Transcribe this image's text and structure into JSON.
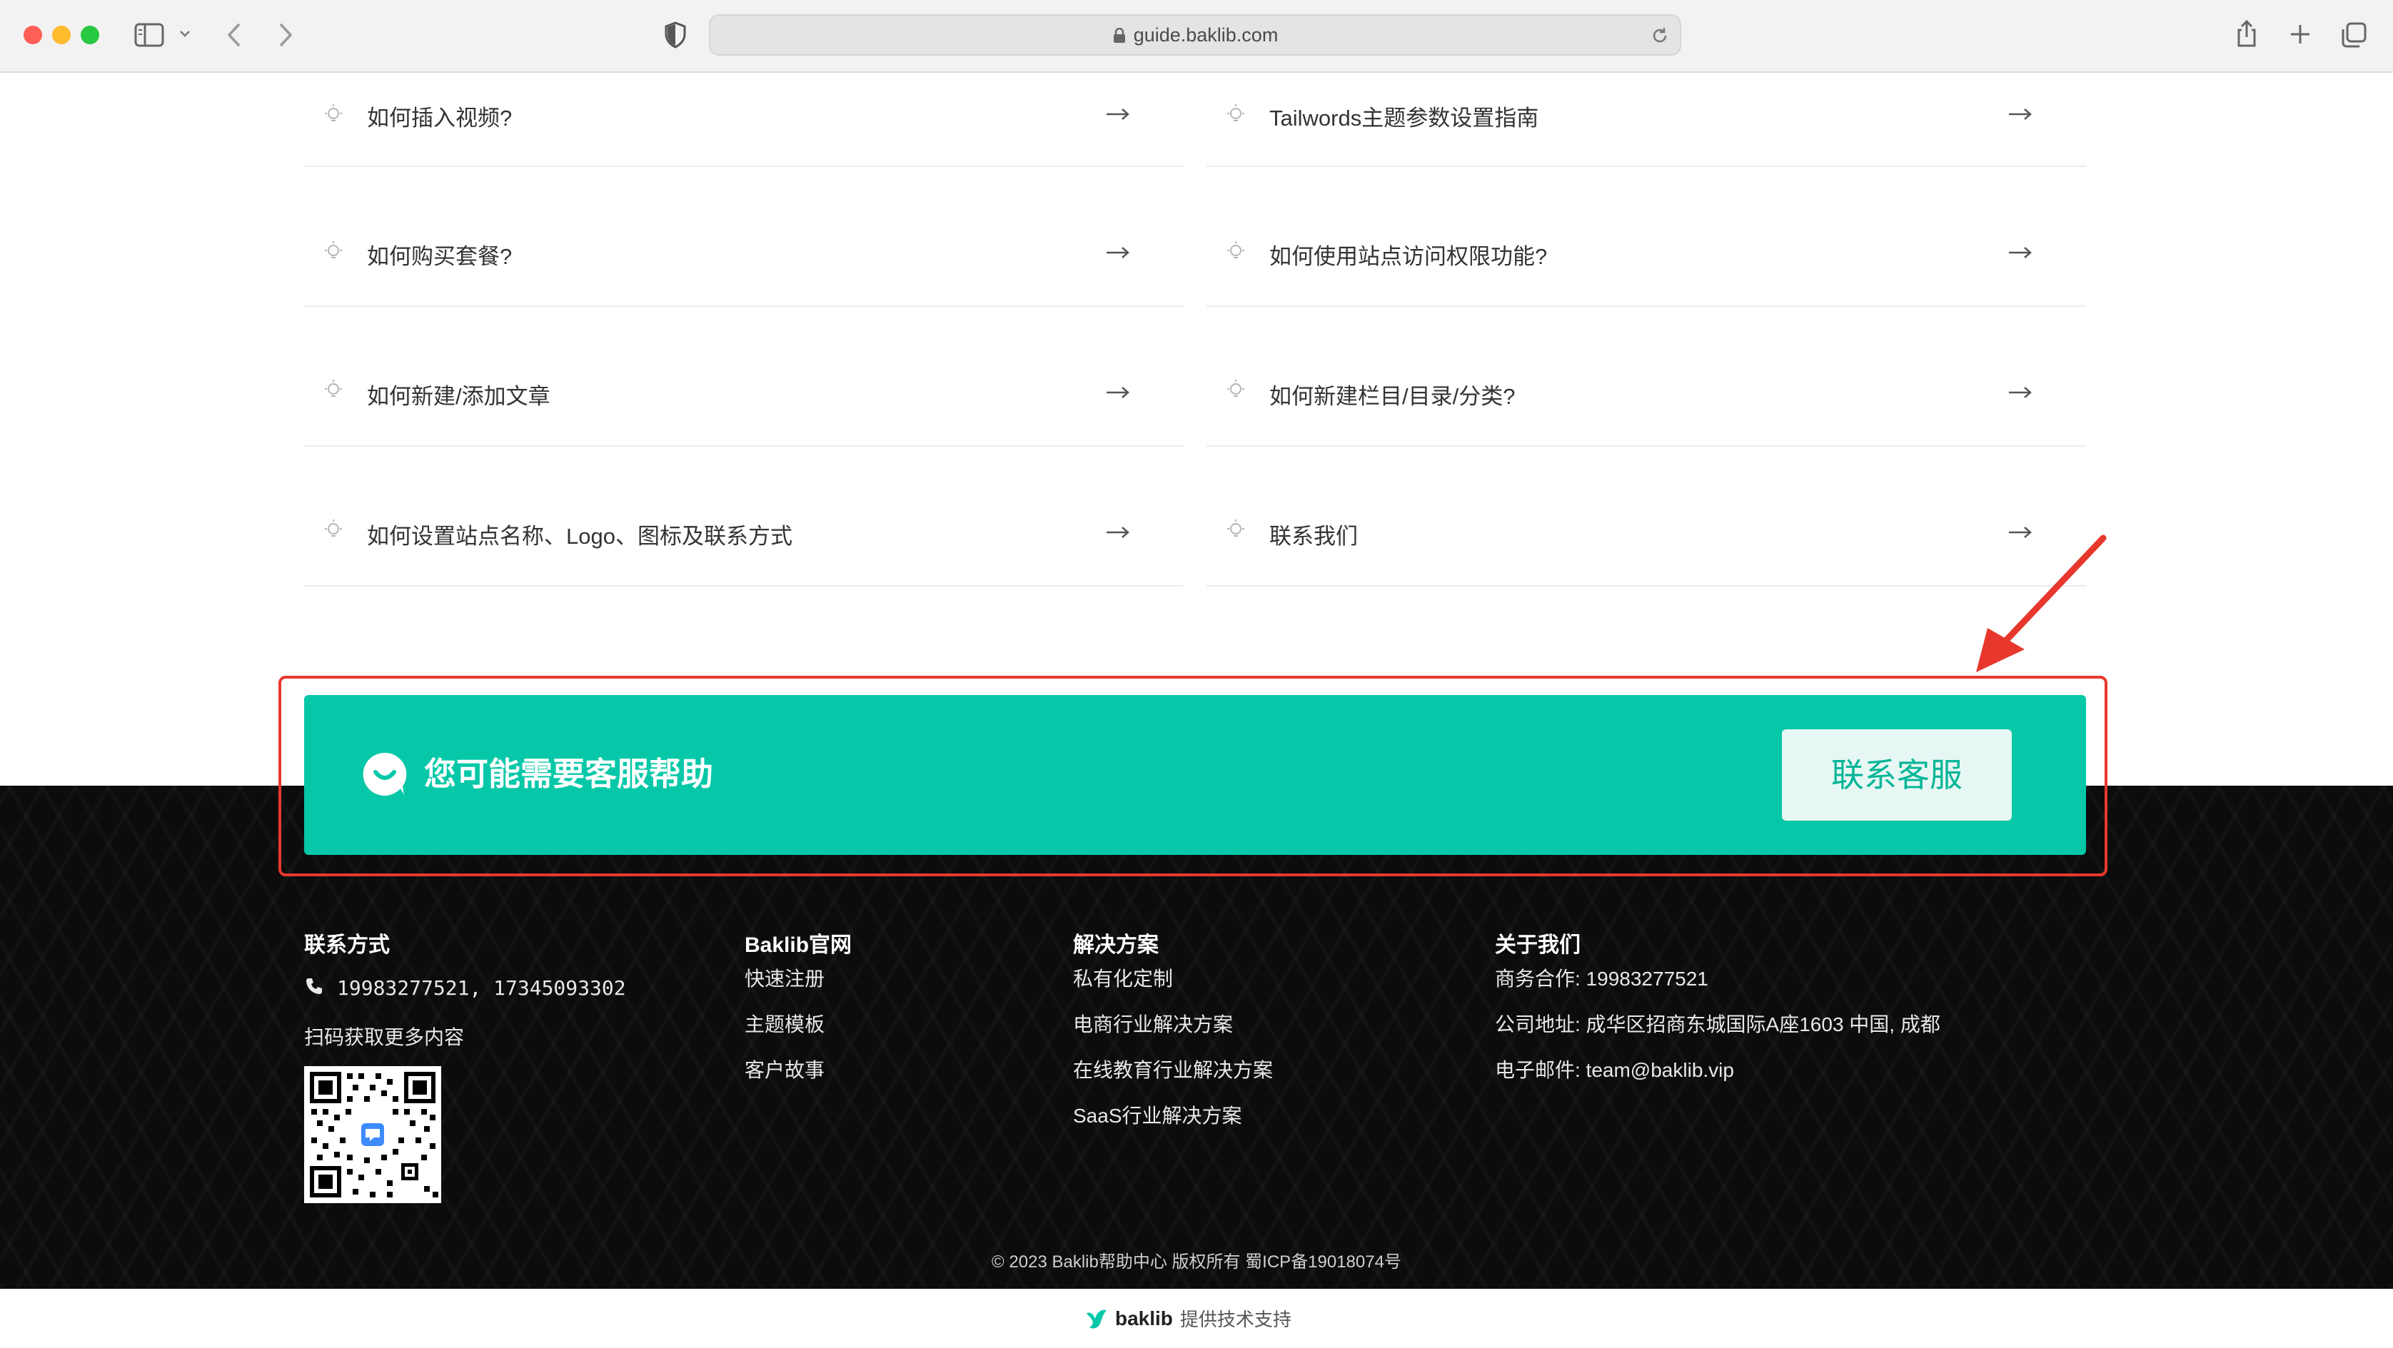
{
  "browser": {
    "url": "guide.baklib.com",
    "traffic_lights": [
      "#fe5f57",
      "#febc2e",
      "#28c840"
    ]
  },
  "articles": {
    "left": [
      {
        "label": "如何插入视频?"
      },
      {
        "label": "如何购买套餐?"
      },
      {
        "label": "如何新建/添加文章"
      },
      {
        "label": "如何设置站点名称、Logo、图标及联系方式"
      }
    ],
    "right": [
      {
        "label": "Tailwords主题参数设置指南"
      },
      {
        "label": "如何使用站点访问权限功能?"
      },
      {
        "label": "如何新建栏目/目录/分类?"
      },
      {
        "label": "联系我们"
      }
    ]
  },
  "cta": {
    "title": "您可能需要客服帮助",
    "button_label": "联系客服",
    "bg_color": "#06c8a8",
    "highlight_color": "#e8382e"
  },
  "footer": {
    "contact": {
      "heading": "联系方式",
      "phones": "19983277521, 17345093302",
      "scan_text": "扫码获取更多内容"
    },
    "official": {
      "heading": "Baklib官网",
      "links": [
        "快速注册",
        "主题模板",
        "客户故事"
      ]
    },
    "solutions": {
      "heading": "解决方案",
      "links": [
        "私有化定制",
        "电商行业解决方案",
        "在线教育行业解决方案",
        "SaaS行业解决方案"
      ]
    },
    "about": {
      "heading": "关于我们",
      "business": "商务合作: 19983277521",
      "address": "公司地址: 成华区招商东城国际A座1603 中国, 成都",
      "email": "电子邮件: team@baklib.vip"
    },
    "copyright": "© 2023 Baklib帮助中心 版权所有 蜀ICP备19018074号"
  },
  "powered": {
    "logo_text": "baklib",
    "text": "提供技术支持"
  }
}
